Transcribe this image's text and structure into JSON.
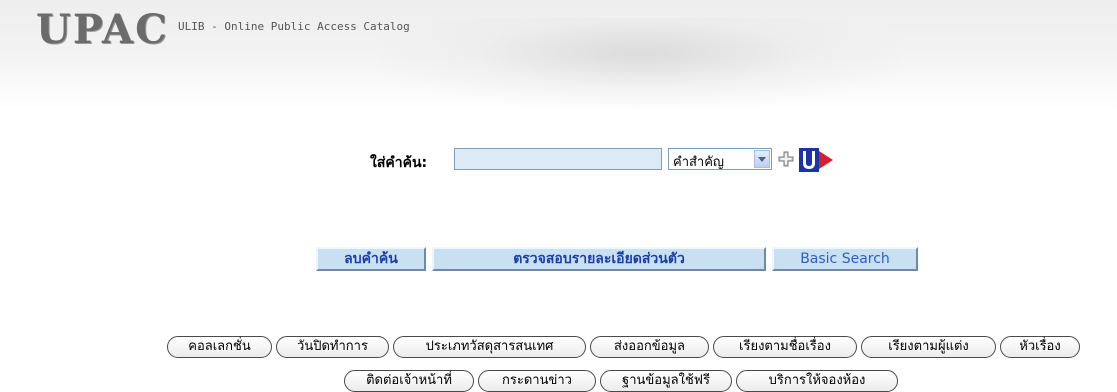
{
  "header": {
    "logo": "UPAC",
    "subtitle": "ULIB - Online Public Access Catalog"
  },
  "search": {
    "label": "ใส่คำค้น:",
    "value": "",
    "type_selected": "คำสำคัญ",
    "icons": [
      "plus-icon",
      "ulib-go-icon"
    ]
  },
  "actions": {
    "clear": "ลบคำค้น",
    "account": "ตรวจสอบรายละเอียดส่วนตัว",
    "basic": "Basic Search"
  },
  "nav": {
    "row1": [
      "คอลเลกชั่น",
      "วันปิดทำการ",
      "ประเภทวัสดุสารสนเทศ",
      "ส่งออกข้อมูล",
      "เรียงตามชื่อเรื่อง",
      "เรียงตามผู้แต่ง",
      "หัวเรื่อง"
    ],
    "row2": [
      "ติดต่อเจ้าหน้าที่",
      "กระดานข่าว",
      "ฐานข้อมูลใช้ฟรี",
      "บริการให้จองห้อง"
    ]
  },
  "colors": {
    "input_bg": "#dceaf6",
    "button_bg": "#c9dff2",
    "button_text": "#1b3fa8",
    "accent_red": "#d2202f",
    "accent_blue": "#1b33a6"
  }
}
